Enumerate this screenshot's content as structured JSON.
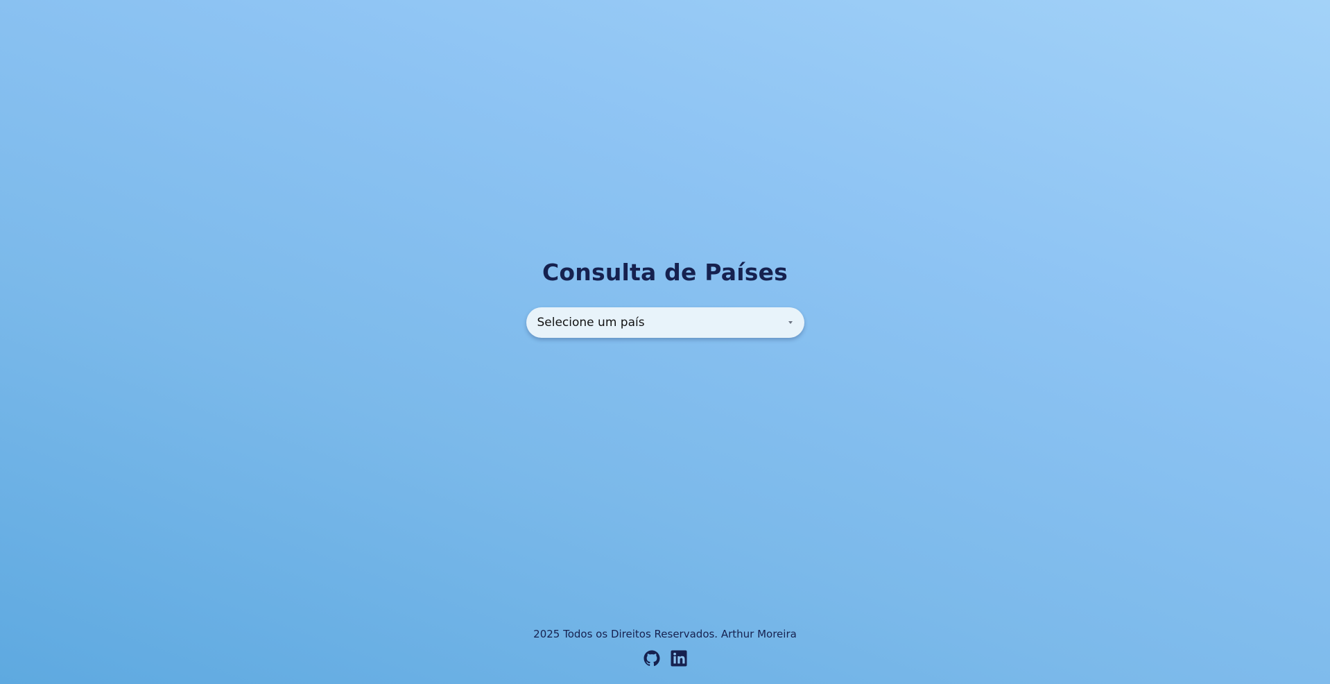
{
  "main": {
    "title": "Consulta de Países",
    "country_select": {
      "selected": "Selecione um país"
    }
  },
  "footer": {
    "copyright": "2025 Todos os Direitos Reservados. Arthur Moreira",
    "social": [
      {
        "icon": "github-icon"
      },
      {
        "icon": "linkedin-icon"
      }
    ]
  },
  "colors": {
    "text_dark": "#16214f",
    "background_start": "#5ea9e0",
    "background_end": "#a3d2f8",
    "select_bg": "#e8f3fa"
  }
}
